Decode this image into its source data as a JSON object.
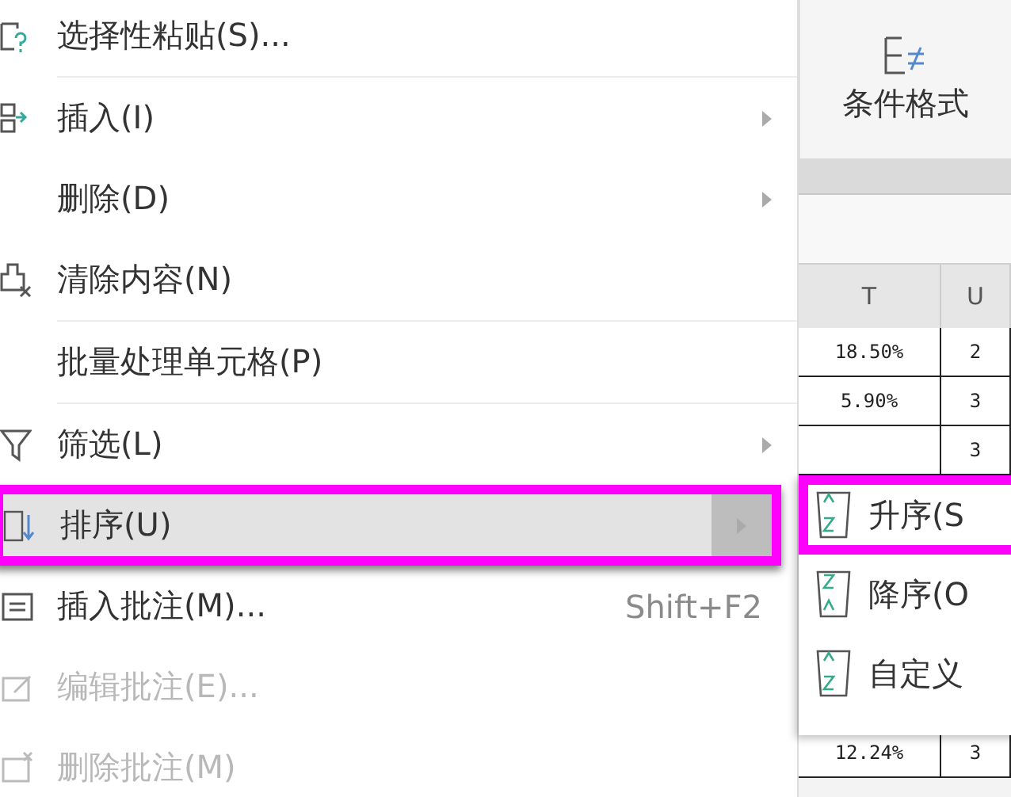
{
  "menu": [
    {
      "label": "选择性粘贴(S)...",
      "kind": "paste",
      "submenu": false,
      "disabled": false,
      "selected": false,
      "highlighted": false,
      "separator_after": true
    },
    {
      "label": "插入(I)",
      "kind": "insert",
      "submenu": true,
      "disabled": false,
      "selected": false,
      "highlighted": false,
      "separator_after": false
    },
    {
      "label": "删除(D)",
      "kind": "plain",
      "submenu": true,
      "disabled": false,
      "selected": false,
      "highlighted": false,
      "separator_after": false
    },
    {
      "label": "清除内容(N)",
      "kind": "clear",
      "submenu": false,
      "disabled": false,
      "selected": false,
      "highlighted": false,
      "separator_after": true
    },
    {
      "label": "批量处理单元格(P)",
      "kind": "plain",
      "submenu": false,
      "disabled": false,
      "selected": false,
      "highlighted": false,
      "separator_after": true
    },
    {
      "label": "筛选(L)",
      "kind": "filter",
      "submenu": true,
      "disabled": false,
      "selected": false,
      "highlighted": false,
      "separator_after": false
    },
    {
      "label": "排序(U)",
      "kind": "sort",
      "submenu": true,
      "disabled": false,
      "selected": true,
      "highlighted": true,
      "separator_after": false
    },
    {
      "label": "插入批注(M)...",
      "kind": "note",
      "shortcut": "Shift+F2",
      "submenu": false,
      "disabled": false,
      "selected": false,
      "highlighted": false,
      "separator_after": false
    },
    {
      "label": "编辑批注(E)...",
      "kind": "edit",
      "submenu": false,
      "disabled": true,
      "selected": false,
      "highlighted": false,
      "separator_after": false
    },
    {
      "label": "删除批注(M)",
      "kind": "remove",
      "submenu": false,
      "disabled": true,
      "selected": false,
      "highlighted": false,
      "separator_after": false
    }
  ],
  "ribbon": {
    "button_label": "条件格式"
  },
  "sheet": {
    "columns": [
      "T",
      "U"
    ],
    "rows": [
      [
        "18.50%",
        "2"
      ],
      [
        "5.90%",
        "3"
      ],
      [
        "",
        "3"
      ]
    ],
    "bottom_row": [
      "12.24%",
      "3"
    ]
  },
  "submenu": [
    {
      "label": "升序(S",
      "kind": "asc",
      "highlighted": true
    },
    {
      "label": "降序(O",
      "kind": "desc",
      "highlighted": false
    },
    {
      "label": "自定义",
      "kind": "custom",
      "highlighted": false
    }
  ]
}
